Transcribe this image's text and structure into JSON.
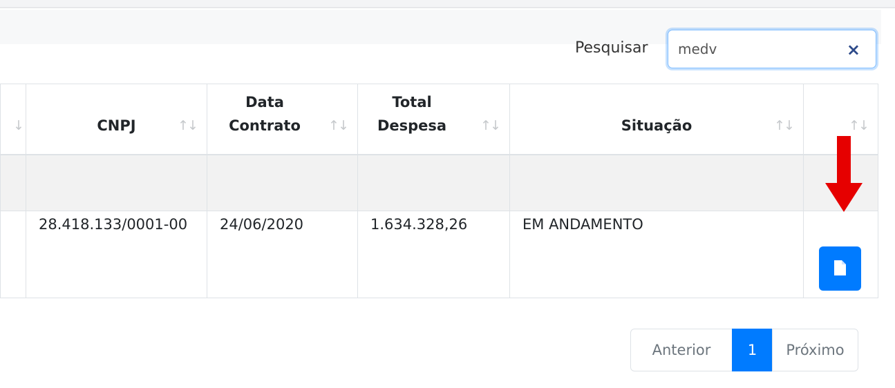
{
  "search": {
    "label": "Pesquisar",
    "value": "medv",
    "clear_glyph": "×"
  },
  "table": {
    "headers": [
      {
        "key": "prev",
        "label": ""
      },
      {
        "key": "cnpj",
        "label": "CNPJ"
      },
      {
        "key": "data_contrato",
        "label": "Data Contrato"
      },
      {
        "key": "total_despesa",
        "label": "Total Despesa"
      },
      {
        "key": "situacao",
        "label": "Situação"
      },
      {
        "key": "acao",
        "label": ""
      }
    ],
    "sort_glyph": "↑↓",
    "rows": [
      {
        "cnpj": "28.418.133/0001-00",
        "data_contrato": "24/06/2020",
        "total_despesa": "1.634.328,26",
        "situacao": "EM ANDAMENTO",
        "action_icon": "document-icon"
      }
    ]
  },
  "annotation": {
    "arrow_color": "#e60000",
    "icon": "red-arrow-down-icon"
  },
  "pagination": {
    "prev_label": "Anterior",
    "current_page": "1",
    "next_label": "Próximo"
  },
  "colors": {
    "primary": "#007bff",
    "border": "#dee2e6",
    "stripe": "#f2f2f2"
  }
}
